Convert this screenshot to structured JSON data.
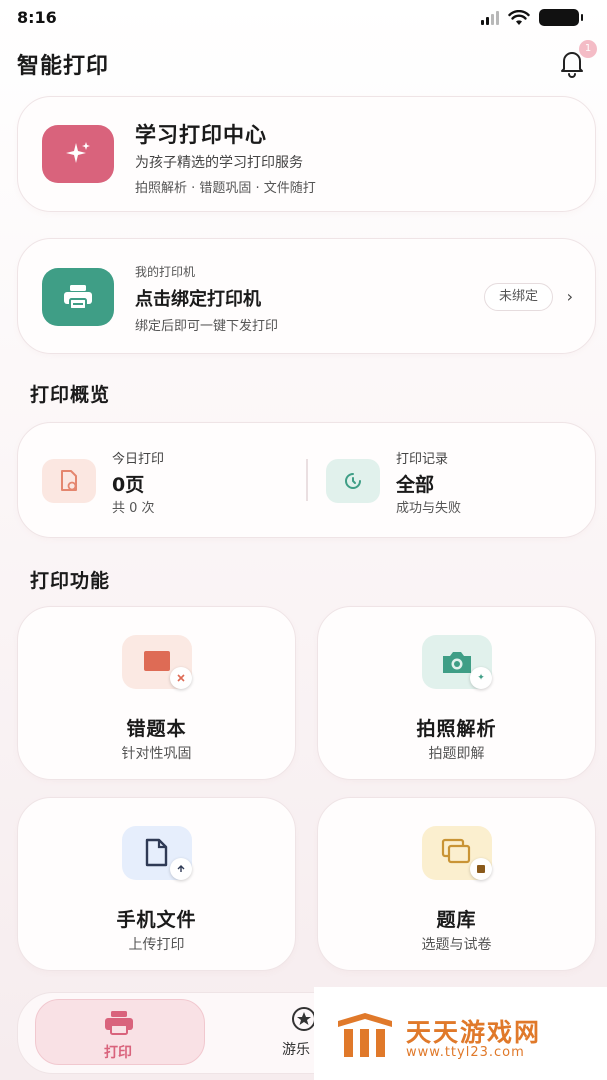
{
  "status": {
    "time": "8:16"
  },
  "header": {
    "title": "智能打印",
    "notification_count": "1"
  },
  "hero": {
    "title": "学习打印中心",
    "subtitle": "为孩子精选的学习打印服务",
    "tags": "拍照解析 · 错题巩固 · 文件随打"
  },
  "printer": {
    "label": "我的打印机",
    "title": "点击绑定打印机",
    "subtitle": "绑定后即可一键下发打印",
    "status": "未绑定"
  },
  "overview": {
    "section_title": "打印概览",
    "today": {
      "label": "今日打印",
      "value": "0页",
      "sub": "共 0 次"
    },
    "records": {
      "label": "打印记录",
      "value": "全部",
      "sub": "成功与失败"
    }
  },
  "features": {
    "section_title": "打印功能",
    "items": [
      {
        "title": "错题本",
        "subtitle": "针对性巩固",
        "icon": "wrong-questions-icon"
      },
      {
        "title": "拍照解析",
        "subtitle": "拍题即解",
        "icon": "camera-icon"
      },
      {
        "title": "手机文件",
        "subtitle": "上传打印",
        "icon": "file-upload-icon"
      },
      {
        "title": "题库",
        "subtitle": "选题与试卷",
        "icon": "question-bank-icon"
      }
    ]
  },
  "tabbar": {
    "items": [
      {
        "label": "打印",
        "active": true
      },
      {
        "label": "游乐"
      }
    ]
  },
  "watermark": {
    "name": "天天游戏网",
    "url": "www.ttyl23.com"
  },
  "colors": {
    "accent_pink": "#d9637c",
    "accent_green": "#3f9e86",
    "watermark_orange": "#e0792a"
  }
}
